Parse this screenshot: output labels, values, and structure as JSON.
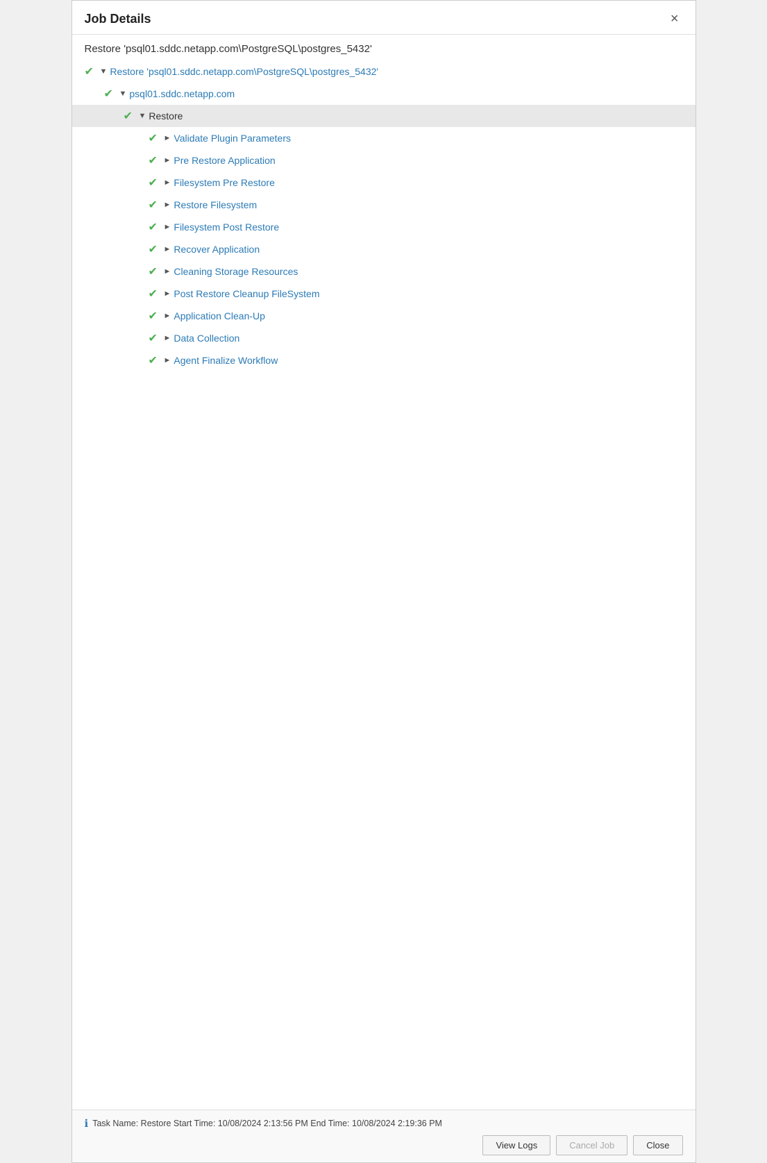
{
  "dialog": {
    "title": "Job Details",
    "subtitle": "Restore 'psql01.sddc.netapp.com\\PostgreSQL\\postgres_5432'",
    "close_label": "×"
  },
  "tree": {
    "root": {
      "label": "Restore 'psql01.sddc.netapp.com\\PostgreSQL\\postgres_5432'",
      "expand": "▼"
    },
    "level1": {
      "label": "psql01.sddc.netapp.com",
      "expand": "▼"
    },
    "level2": {
      "label": "Restore",
      "expand": "▼"
    },
    "items": [
      {
        "label": "Validate Plugin Parameters"
      },
      {
        "label": "Pre Restore Application"
      },
      {
        "label": "Filesystem Pre Restore"
      },
      {
        "label": "Restore Filesystem"
      },
      {
        "label": "Filesystem Post Restore"
      },
      {
        "label": "Recover Application"
      },
      {
        "label": "Cleaning Storage Resources"
      },
      {
        "label": "Post Restore Cleanup FileSystem"
      },
      {
        "label": "Application Clean-Up"
      },
      {
        "label": "Data Collection"
      },
      {
        "label": "Agent Finalize Workflow"
      }
    ]
  },
  "footer": {
    "status": "Task Name: Restore  Start Time: 10/08/2024 2:13:56 PM  End Time: 10/08/2024 2:19:36 PM",
    "buttons": {
      "view_logs": "View Logs",
      "cancel_job": "Cancel Job",
      "close": "Close"
    }
  },
  "icons": {
    "check": "✔",
    "expand_open": "▼",
    "expand_closed": "►",
    "info": "ℹ"
  }
}
